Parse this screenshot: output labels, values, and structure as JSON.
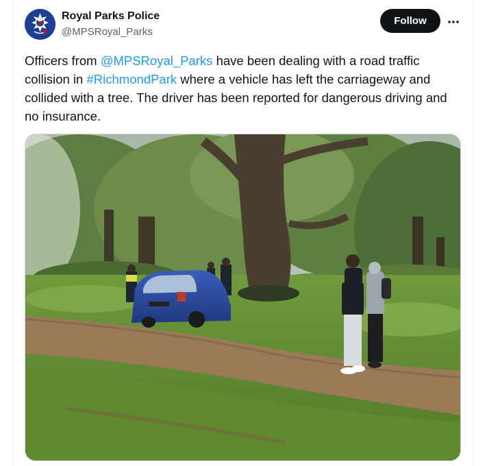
{
  "author": {
    "display_name": "Royal Parks Police",
    "handle": "@MPSRoyal_Parks",
    "avatar_icon": "metropolitan-police-crest-icon"
  },
  "actions": {
    "follow_label": "Follow",
    "more_icon": "more-dots-icon"
  },
  "tweet": {
    "text_1": "Officers from ",
    "mention": "@MPSRoyal_Parks",
    "text_2": " have been dealing with a road traffic collision in ",
    "hashtag": "#RichmondPark",
    "text_3": " where a vehicle has left the carriageway and collided with a tree. The driver has been reported for dangerous driving and no insurance."
  },
  "media": {
    "photo_icon": "collision-photo"
  },
  "colors": {
    "link": "#1d9bf0",
    "follow_bg": "#0f1419",
    "text": "#0f1419",
    "secondary": "#536471"
  }
}
